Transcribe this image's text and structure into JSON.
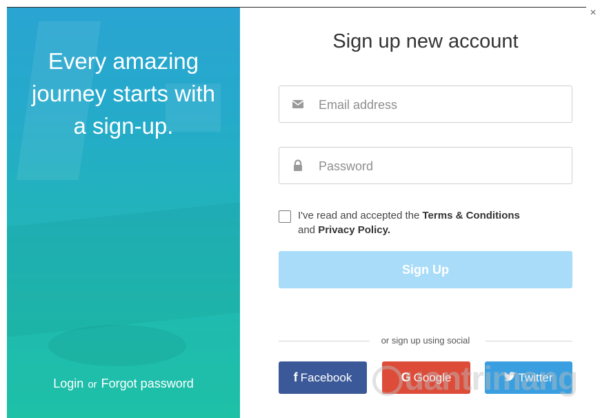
{
  "left_panel": {
    "tagline_lines": [
      "Every amazing",
      "journey starts with",
      "a sign-up."
    ],
    "login_label": "Login",
    "or_label": "or",
    "forgot_label": "Forgot password"
  },
  "form": {
    "title": "Sign up new account",
    "email_placeholder": "Email address",
    "email_icon": "envelope-icon",
    "password_placeholder": "Password",
    "password_icon": "lock-icon",
    "terms_prefix": "I've read and accepted the ",
    "terms_link": "Terms & Conditions",
    "terms_middle": "and ",
    "privacy_link": "Privacy Policy.",
    "terms_checked": false,
    "signup_label": "Sign Up",
    "social_divider": "or sign up using social"
  },
  "social": {
    "facebook_label": "Facebook",
    "google_label": "Google",
    "twitter_label": "Twitter"
  },
  "watermark": "uantrimang",
  "close_label": "×",
  "colors": {
    "panel_top": "#2aa4d2",
    "panel_bottom": "#1ec0a6",
    "signup_button": "#a9dcf9",
    "facebook": "#3b5998",
    "google": "#dd4b39",
    "twitter": "#3a9fe0"
  }
}
